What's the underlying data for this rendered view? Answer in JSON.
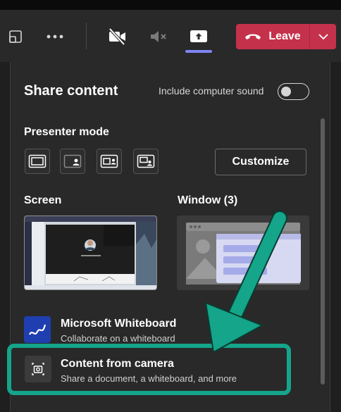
{
  "toolbar": {
    "items": [
      {
        "icon": "view-icon"
      },
      {
        "icon": "more-options-icon"
      },
      {
        "icon": "camera-off-icon"
      },
      {
        "icon": "mic-off-icon"
      },
      {
        "icon": "share-tray-icon"
      }
    ],
    "leave": {
      "label": "Leave",
      "icon": "hangup-icon",
      "color": "#c4314b"
    }
  },
  "share_panel": {
    "title": "Share content",
    "include_sound_label": "Include computer sound",
    "include_sound_on": false,
    "presenter_mode": {
      "heading": "Presenter mode",
      "modes": [
        {
          "icon": "content-only-icon"
        },
        {
          "icon": "standout-icon"
        },
        {
          "icon": "side-by-side-icon"
        },
        {
          "icon": "reporter-icon"
        }
      ],
      "customize_label": "Customize"
    },
    "screen": {
      "heading": "Screen"
    },
    "window": {
      "heading": "Window (3)"
    },
    "items": [
      {
        "title": "Microsoft Whiteboard",
        "subtitle": "Collaborate on a whiteboard",
        "icon": "whiteboard-icon"
      },
      {
        "title": "Content from camera",
        "subtitle": "Share a document, a whiteboard, and more",
        "icon": "camera-content-icon"
      }
    ]
  },
  "annotation": {
    "color": "#14a58a"
  }
}
